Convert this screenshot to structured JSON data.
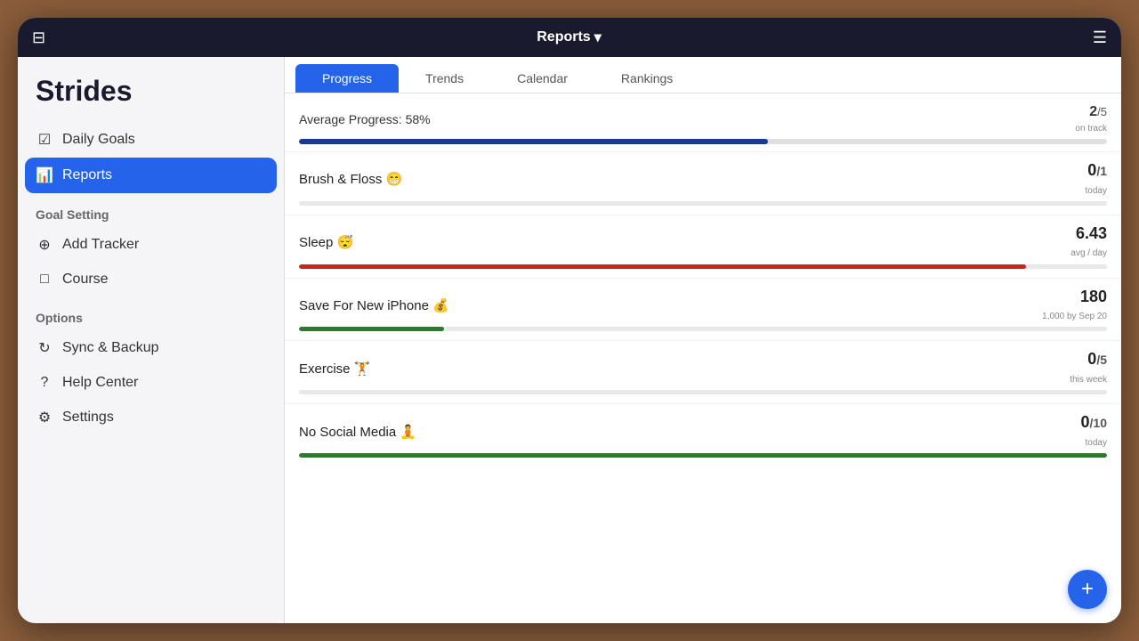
{
  "app": {
    "title": "Strides",
    "top_bar": {
      "report_title": "Reports",
      "report_dropdown": "▾"
    }
  },
  "sidebar": {
    "app_name": "Strides",
    "nav_items": [
      {
        "id": "daily-goals",
        "label": "Daily Goals",
        "icon": "✓",
        "active": false
      },
      {
        "id": "reports",
        "label": "Reports",
        "icon": "📊",
        "active": true
      }
    ],
    "goal_setting_label": "Goal Setting",
    "goal_setting_items": [
      {
        "id": "add-tracker",
        "label": "Add Tracker",
        "icon": "+"
      },
      {
        "id": "course",
        "label": "Course",
        "icon": "□"
      }
    ],
    "options_label": "Options",
    "options_items": [
      {
        "id": "sync-backup",
        "label": "Sync & Backup",
        "icon": "↻"
      },
      {
        "id": "help-center",
        "label": "Help Center",
        "icon": "?"
      },
      {
        "id": "settings",
        "label": "Settings",
        "icon": "⚙"
      }
    ]
  },
  "tabs": [
    {
      "id": "progress",
      "label": "Progress",
      "active": true
    },
    {
      "id": "trends",
      "label": "Trends",
      "active": false
    },
    {
      "id": "calendar",
      "label": "Calendar",
      "active": false
    },
    {
      "id": "rankings",
      "label": "Rankings",
      "active": false
    }
  ],
  "average_progress": {
    "label": "Average Progress: 58%",
    "value": "2",
    "denom": "/5",
    "sub": "on track",
    "percent": 58,
    "bar_color": "#1a3a8f"
  },
  "goals": [
    {
      "id": "brush-floss",
      "name": "Brush & Floss 😁",
      "value": "0",
      "denom": "/1",
      "sub": "today",
      "percent": 0,
      "bar_color": "#888"
    },
    {
      "id": "sleep",
      "name": "Sleep 😴",
      "value": "6.43",
      "denom": "",
      "sub": "avg / day",
      "percent": 90,
      "bar_color": "#cc2222"
    },
    {
      "id": "save-iphone",
      "name": "Save For New iPhone 💰",
      "value": "180",
      "denom": "",
      "sub": "1,000 by Sep 20",
      "percent": 18,
      "bar_color": "#2d7a2d"
    },
    {
      "id": "exercise",
      "name": "Exercise 🏋",
      "value": "0",
      "denom": "/5",
      "sub": "this week",
      "percent": 0,
      "bar_color": "#888"
    },
    {
      "id": "no-social-media",
      "name": "No Social Media 🧘",
      "value": "0",
      "denom": "/10",
      "sub": "today",
      "percent": 100,
      "bar_color": "#2d7a2d"
    }
  ],
  "fab": {
    "label": "+"
  }
}
